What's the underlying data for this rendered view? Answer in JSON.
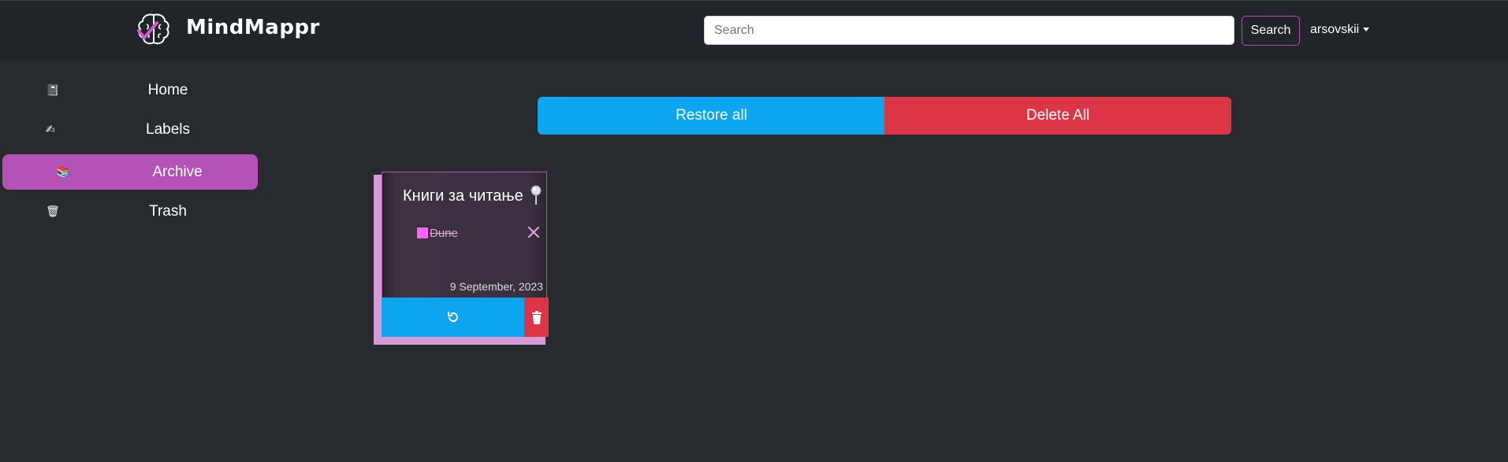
{
  "header": {
    "brand": "MindMappr",
    "search": {
      "placeholder": "Search",
      "value": ""
    },
    "search_button": "Search",
    "user": "arsovskii"
  },
  "sidebar": {
    "items": [
      {
        "label": "Home",
        "icon": "notebook-icon",
        "active": false
      },
      {
        "label": "Labels",
        "icon": "label-hand-icon",
        "active": false
      },
      {
        "label": "Archive",
        "icon": "books-icon",
        "active": true
      },
      {
        "label": "Trash",
        "icon": "trash-can-icon",
        "active": false
      }
    ]
  },
  "actions": {
    "restore_all": "Restore all",
    "delete_all": "Delete All"
  },
  "notes": [
    {
      "title": "Книги за читање",
      "items": [
        {
          "text": "Dune",
          "checked": true
        }
      ],
      "date": "9 September, 2023"
    }
  ],
  "colors": {
    "accent": "#b453b5",
    "restore": "#0ea5f0",
    "danger": "#dc3545",
    "background": "#272b30",
    "navbar": "#212428"
  }
}
